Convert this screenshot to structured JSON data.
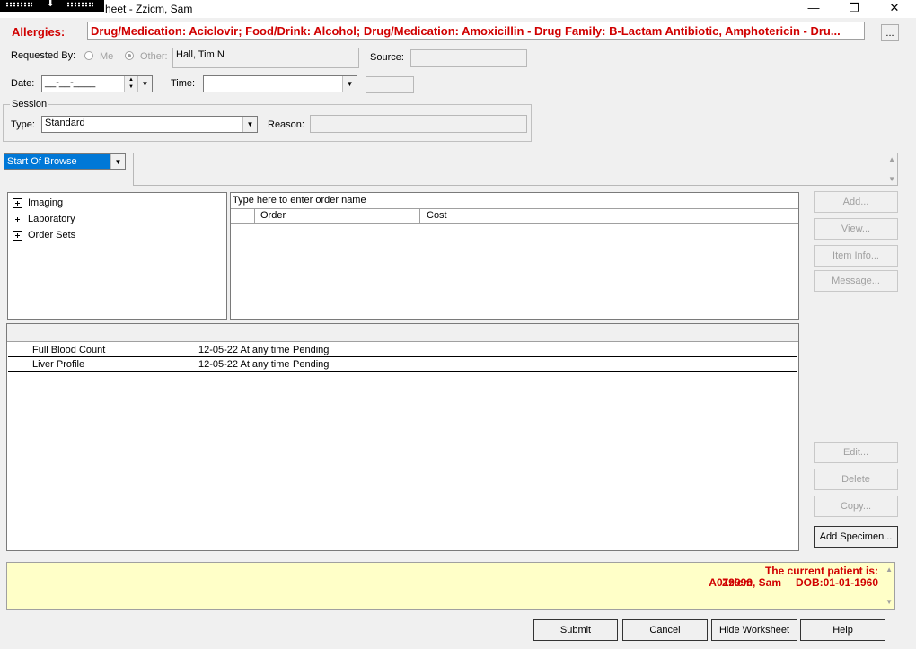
{
  "window": {
    "title": "heet - Zzicm, Sam",
    "minimize_glyph": "—",
    "restore_glyph": "❐",
    "close_glyph": "✕"
  },
  "allergies": {
    "label": "Allergies:",
    "text": "Drug/Medication: Aciclovir; Food/Drink: Alcohol; Drug/Medication: Amoxicillin - Drug Family: B-Lactam Antibiotic, Amphotericin - Dru...",
    "more_button": "..."
  },
  "requested_by": {
    "label": "Requested By:",
    "option_me": "Me",
    "option_other": "Other:",
    "selected": "Other",
    "value": "Hall, Tim N"
  },
  "source": {
    "label": "Source:",
    "value": ""
  },
  "date": {
    "label": "Date:",
    "value": "__-__-____"
  },
  "time": {
    "label": "Time:",
    "value": ""
  },
  "session": {
    "legend": "Session",
    "type_label": "Type:",
    "type_value": "Standard",
    "reason_label": "Reason:",
    "reason_value": ""
  },
  "browse": {
    "value": "Start Of Browse"
  },
  "tree": {
    "items": [
      {
        "label": "Imaging"
      },
      {
        "label": "Laboratory"
      },
      {
        "label": "Order Sets"
      }
    ]
  },
  "order_search": {
    "placeholder": "Type here to enter order name",
    "columns": [
      "Order",
      "Cost"
    ]
  },
  "side_buttons_top": [
    "Add...",
    "View...",
    "Item Info...",
    "Message..."
  ],
  "orders": [
    {
      "name": "Full Blood Count",
      "when": "12-05-22 At any time",
      "status": "Pending"
    },
    {
      "name": "Liver Profile",
      "when": "12-05-22 At any time",
      "status": "Pending"
    }
  ],
  "side_buttons_bottom": [
    "Edit...",
    "Delete",
    "Copy..."
  ],
  "add_specimen": "Add Specimen...",
  "patient": {
    "heading": "The current patient is:",
    "id": "A019999",
    "name": "Zzicm, Sam",
    "dob": "DOB:01-01-1960"
  },
  "footer": {
    "submit": "Submit",
    "cancel": "Cancel",
    "hide_worksheet": "Hide Worksheet",
    "help": "Help"
  },
  "colors": {
    "allergy_red": "#d00000",
    "patient_bg": "#ffffc8",
    "selection_blue": "#0078d7"
  }
}
